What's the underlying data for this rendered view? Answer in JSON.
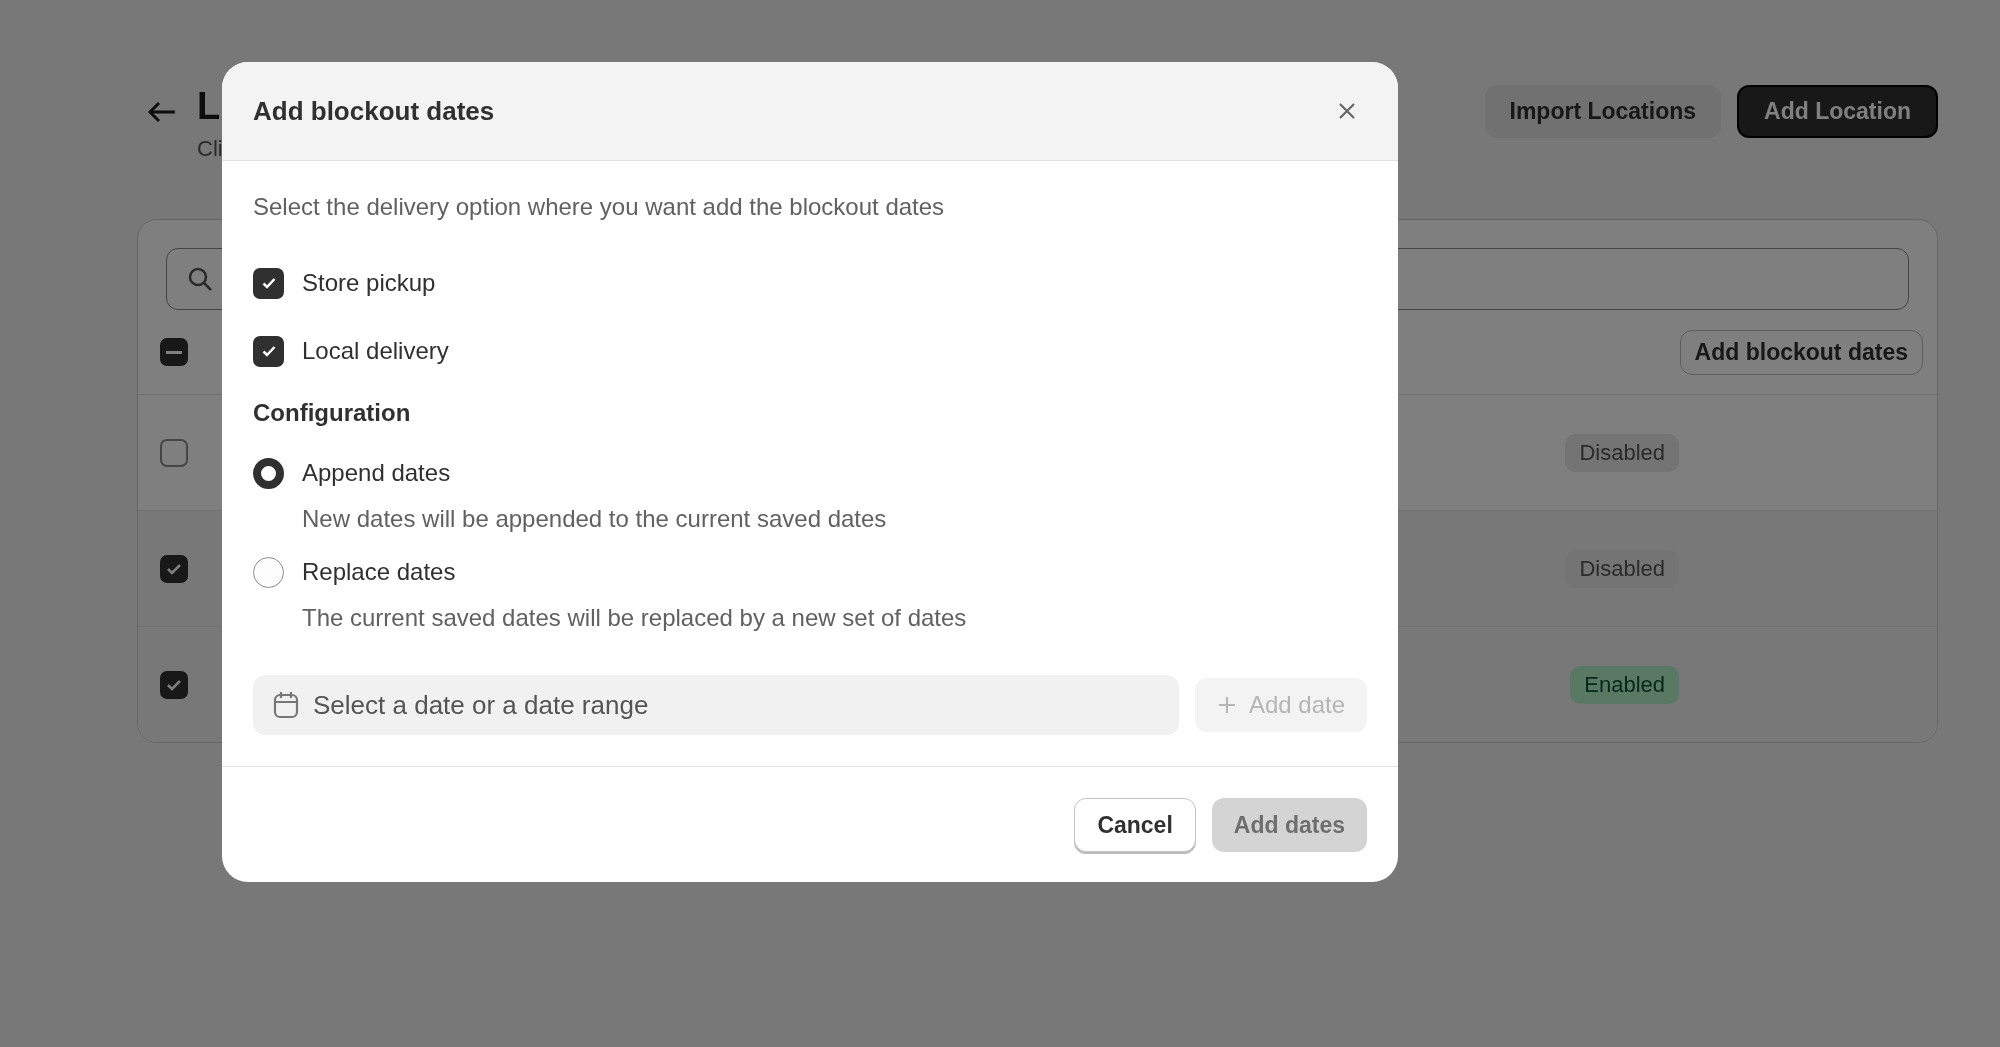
{
  "page": {
    "title": "L",
    "subtitle": "Cli",
    "actions": [
      {
        "label": "Import Locations",
        "kind": "secondary"
      },
      {
        "label": "Add Location",
        "kind": "primary"
      }
    ]
  },
  "table": {
    "select_all_indeterminate": true,
    "bulk_action": "Add blockout dates",
    "rows": [
      {
        "selected": false,
        "status": "Disabled",
        "enabled": false
      },
      {
        "selected": true,
        "status": "Disabled",
        "enabled": false
      },
      {
        "selected": true,
        "status": "Enabled",
        "enabled": true
      }
    ]
  },
  "dialog": {
    "title": "Add blockout dates",
    "description": "Select the delivery option where you want add the blockout dates",
    "options": [
      {
        "label": "Store pickup",
        "checked": true
      },
      {
        "label": "Local delivery",
        "checked": true
      }
    ],
    "configuration": {
      "heading": "Configuration",
      "choices": [
        {
          "label": "Append dates",
          "help": "New dates will be appended to the current saved dates",
          "selected": true
        },
        {
          "label": "Replace dates",
          "help": "The current saved dates will be replaced by a new set of dates",
          "selected": false
        }
      ]
    },
    "date_field": {
      "placeholder": "Select a date or a date range"
    },
    "add_date": {
      "label": "Add date",
      "disabled": true
    },
    "footer": {
      "cancel": "Cancel",
      "confirm": {
        "label": "Add dates",
        "disabled": true
      }
    }
  }
}
